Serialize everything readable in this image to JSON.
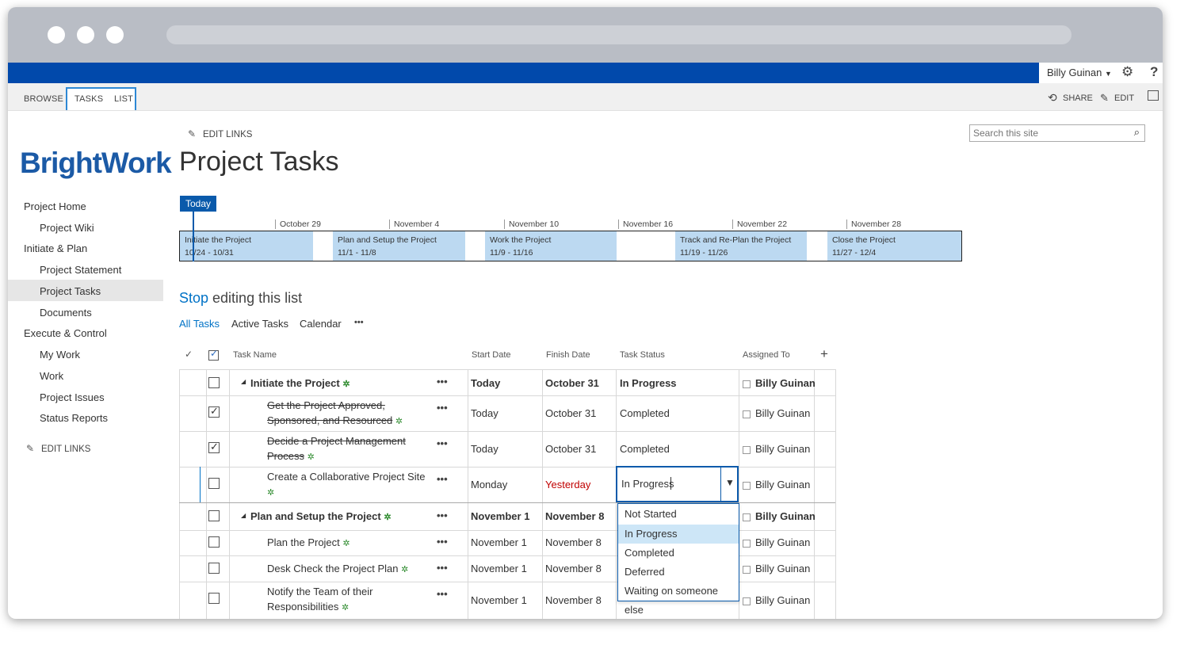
{
  "suite": {
    "user": "Billy Guinan"
  },
  "ribbon": {
    "tabs": [
      "BROWSE",
      "TASKS",
      "LIST"
    ],
    "share": "SHARE",
    "edit": "EDIT"
  },
  "top": {
    "edit_links": "EDIT LINKS",
    "search_placeholder": "Search this site"
  },
  "logo": "BrightWork",
  "page_title": "Project Tasks",
  "nav": {
    "items": [
      "Project Home",
      "Project Wiki",
      "Initiate & Plan",
      "Project Statement",
      "Project Tasks",
      "Documents",
      "Execute & Control",
      "My Work",
      "Work",
      "Project Issues",
      "Status Reports"
    ],
    "edit_links": "EDIT LINKS"
  },
  "timeline": {
    "today": "Today",
    "dates": [
      "October 29",
      "November 4",
      "November 10",
      "November 16",
      "November 22",
      "November 28"
    ],
    "bars": [
      {
        "name": "Initiate the Project",
        "range": "10/24 - 10/31"
      },
      {
        "name": "Plan and Setup the Project",
        "range": "11/1 - 11/8"
      },
      {
        "name": "Work the Project",
        "range": "11/9 - 11/16"
      },
      {
        "name": "Track and Re-Plan the Project",
        "range": "11/19 - 11/26"
      },
      {
        "name": "Close the Project",
        "range": "11/27 - 12/4"
      }
    ]
  },
  "edit_mode": {
    "stop": "Stop",
    "rest": " editing this list"
  },
  "views": {
    "all": "All Tasks",
    "active": "Active Tasks",
    "calendar": "Calendar",
    "more": "•••"
  },
  "columns": {
    "name": "Task Name",
    "start": "Start Date",
    "finish": "Finish Date",
    "status": "Task Status",
    "assigned": "Assigned To"
  },
  "rows": [
    {
      "name": "Initiate the Project",
      "start": "Today",
      "finish": "October 31",
      "status": "In Progress",
      "assigned": "Billy Guinan"
    },
    {
      "name1": "Get the Project Approved,",
      "name2": "Sponsored, and Resourced",
      "start": "Today",
      "finish": "October 31",
      "status": "Completed",
      "assigned": "Billy Guinan"
    },
    {
      "name1": "Decide a Project Management",
      "name2": "Process",
      "start": "Today",
      "finish": "October 31",
      "status": "Completed",
      "assigned": "Billy Guinan"
    },
    {
      "name": "Create a Collaborative Project Site",
      "start": "Monday",
      "finish": "Yesterday",
      "status": "In Progress",
      "assigned": "Billy Guinan"
    },
    {
      "name": "Plan and Setup the Project",
      "start": "November 1",
      "finish": "November 8",
      "status": "",
      "assigned": "Billy Guinan"
    },
    {
      "name": "Plan the Project",
      "start": "November 1",
      "finish": "November 8",
      "status": "",
      "assigned": "Billy Guinan"
    },
    {
      "name": "Desk Check the Project Plan",
      "start": "November 1",
      "finish": "November 8",
      "status": "",
      "assigned": "Billy Guinan"
    },
    {
      "name1": "Notify the Team of their",
      "name2": "Responsibilities",
      "start": "November 1",
      "finish": "November 8",
      "status": "",
      "assigned": "Billy Guinan"
    }
  ],
  "dropdown": {
    "options": [
      "Not Started",
      "In Progress",
      "Completed",
      "Deferred",
      "Waiting on someone else"
    ],
    "selected": "In Progress"
  },
  "colors": {
    "suite": "#0149ab",
    "accent": "#0072c6",
    "overdue": "#c00000",
    "timeline_bar": "#bcd9f1",
    "logo": "#1b5aa6"
  }
}
